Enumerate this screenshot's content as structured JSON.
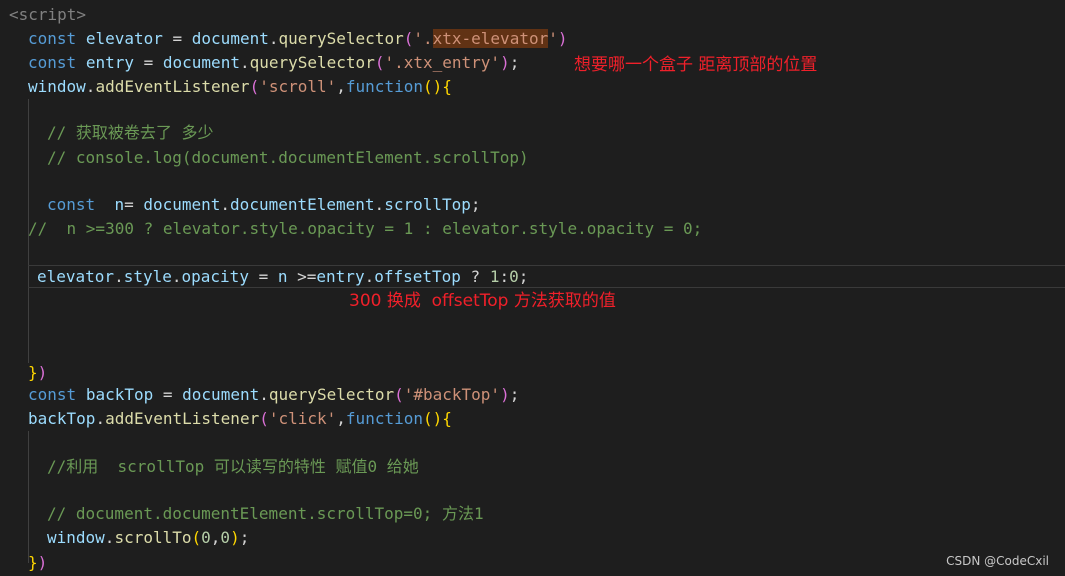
{
  "lines": [
    {
      "tokens": [
        {
          "t": "<script>",
          "c": "tag"
        }
      ]
    },
    {
      "tokens": [
        {
          "t": "const",
          "c": "kw"
        },
        {
          "t": " ",
          "c": "op"
        },
        {
          "t": "elevator",
          "c": "var"
        },
        {
          "t": " = ",
          "c": "op"
        },
        {
          "t": "document",
          "c": "var"
        },
        {
          "t": ".",
          "c": "op"
        },
        {
          "t": "querySelector",
          "c": "fn"
        },
        {
          "t": "(",
          "c": "br2"
        },
        {
          "t": "'.",
          "c": "str"
        },
        {
          "t": "xtx-elevator",
          "c": "str hl"
        },
        {
          "t": "'",
          "c": "str"
        },
        {
          "t": ")",
          "c": "br2"
        }
      ]
    },
    {
      "tokens": [
        {
          "t": "const",
          "c": "kw"
        },
        {
          "t": " ",
          "c": "op"
        },
        {
          "t": "entry",
          "c": "var"
        },
        {
          "t": " = ",
          "c": "op"
        },
        {
          "t": "document",
          "c": "var"
        },
        {
          "t": ".",
          "c": "op"
        },
        {
          "t": "querySelector",
          "c": "fn"
        },
        {
          "t": "(",
          "c": "br2"
        },
        {
          "t": "'.xtx_entry'",
          "c": "str"
        },
        {
          "t": ")",
          "c": "br2"
        },
        {
          "t": ";",
          "c": "op"
        }
      ]
    },
    {
      "tokens": [
        {
          "t": "window",
          "c": "var"
        },
        {
          "t": ".",
          "c": "op"
        },
        {
          "t": "addEventListener",
          "c": "fn"
        },
        {
          "t": "(",
          "c": "br2"
        },
        {
          "t": "'scroll'",
          "c": "str"
        },
        {
          "t": ",",
          "c": "op"
        },
        {
          "t": "function",
          "c": "kw"
        },
        {
          "t": "()",
          "c": "br1"
        },
        {
          "t": "{",
          "c": "br1"
        }
      ]
    },
    {
      "tokens": [
        {
          "t": "// 获取被卷去了 多少",
          "c": "cm"
        }
      ]
    },
    {
      "tokens": [
        {
          "t": "// console.log(document.documentElement.scrollTop)",
          "c": "cm"
        }
      ]
    },
    {
      "tokens": [
        {
          "t": "const",
          "c": "kw"
        },
        {
          "t": "  ",
          "c": "op"
        },
        {
          "t": "n",
          "c": "var"
        },
        {
          "t": "= ",
          "c": "op"
        },
        {
          "t": "document",
          "c": "var"
        },
        {
          "t": ".",
          "c": "op"
        },
        {
          "t": "documentElement",
          "c": "var"
        },
        {
          "t": ".",
          "c": "op"
        },
        {
          "t": "scrollTop",
          "c": "var"
        },
        {
          "t": ";",
          "c": "op"
        }
      ]
    },
    {
      "tokens": [
        {
          "t": "//  n >=300 ? elevator.style.opacity = 1 : elevator.style.opacity = 0;",
          "c": "cm"
        }
      ]
    },
    {
      "tokens": [
        {
          "t": "elevator",
          "c": "var"
        },
        {
          "t": ".",
          "c": "op"
        },
        {
          "t": "style",
          "c": "var"
        },
        {
          "t": ".",
          "c": "op"
        },
        {
          "t": "opacity",
          "c": "var"
        },
        {
          "t": " = ",
          "c": "op"
        },
        {
          "t": "n",
          "c": "var"
        },
        {
          "t": " >=",
          "c": "op"
        },
        {
          "t": "entry",
          "c": "var"
        },
        {
          "t": ".",
          "c": "op"
        },
        {
          "t": "offsetTop",
          "c": "var"
        },
        {
          "t": " ? ",
          "c": "op"
        },
        {
          "t": "1",
          "c": "num"
        },
        {
          "t": ":",
          "c": "op"
        },
        {
          "t": "0",
          "c": "num"
        },
        {
          "t": ";",
          "c": "op"
        }
      ]
    },
    {
      "tokens": [
        {
          "t": "}",
          "c": "br1"
        },
        {
          "t": ")",
          "c": "br2"
        }
      ]
    },
    {
      "tokens": [
        {
          "t": "const",
          "c": "kw"
        },
        {
          "t": " ",
          "c": "op"
        },
        {
          "t": "backTop",
          "c": "var"
        },
        {
          "t": " = ",
          "c": "op"
        },
        {
          "t": "document",
          "c": "var"
        },
        {
          "t": ".",
          "c": "op"
        },
        {
          "t": "querySelector",
          "c": "fn"
        },
        {
          "t": "(",
          "c": "br2"
        },
        {
          "t": "'#backTop'",
          "c": "str"
        },
        {
          "t": ")",
          "c": "br2"
        },
        {
          "t": ";",
          "c": "op"
        }
      ]
    },
    {
      "tokens": [
        {
          "t": "backTop",
          "c": "var"
        },
        {
          "t": ".",
          "c": "op"
        },
        {
          "t": "addEventListener",
          "c": "fn"
        },
        {
          "t": "(",
          "c": "br2"
        },
        {
          "t": "'click'",
          "c": "str"
        },
        {
          "t": ",",
          "c": "op"
        },
        {
          "t": "function",
          "c": "kw"
        },
        {
          "t": "()",
          "c": "br1"
        },
        {
          "t": "{",
          "c": "br1"
        }
      ]
    },
    {
      "tokens": [
        {
          "t": "//利用  scrollTop 可以读写的特性 赋值0 给她",
          "c": "cm"
        }
      ]
    },
    {
      "tokens": [
        {
          "t": "// document.documentElement.scrollTop=0; 方法1",
          "c": "cm"
        }
      ]
    },
    {
      "tokens": [
        {
          "t": "window",
          "c": "var"
        },
        {
          "t": ".",
          "c": "op"
        },
        {
          "t": "scrollTo",
          "c": "fn"
        },
        {
          "t": "(",
          "c": "br1"
        },
        {
          "t": "0",
          "c": "num"
        },
        {
          "t": ",",
          "c": "op"
        },
        {
          "t": "0",
          "c": "num"
        },
        {
          "t": ")",
          "c": "br1"
        },
        {
          "t": ";",
          "c": "op"
        }
      ]
    },
    {
      "tokens": [
        {
          "t": "}",
          "c": "br1"
        },
        {
          "t": ")",
          "c": "br2"
        }
      ]
    }
  ],
  "annotations": {
    "offset_note": "想要哪一个盒子 距离顶部的位置",
    "replace_note": "300 换成  offsetTop 方法获取的值"
  },
  "watermark": "CSDN @CodeCxil",
  "colors": {
    "background": "#1e1e1e",
    "annotation": "#f0202a",
    "keyword": "#569cd6",
    "variable": "#9cdcfe",
    "function": "#dcdcaa",
    "string": "#ce9178",
    "comment": "#6a9955",
    "number": "#b5cea8"
  }
}
